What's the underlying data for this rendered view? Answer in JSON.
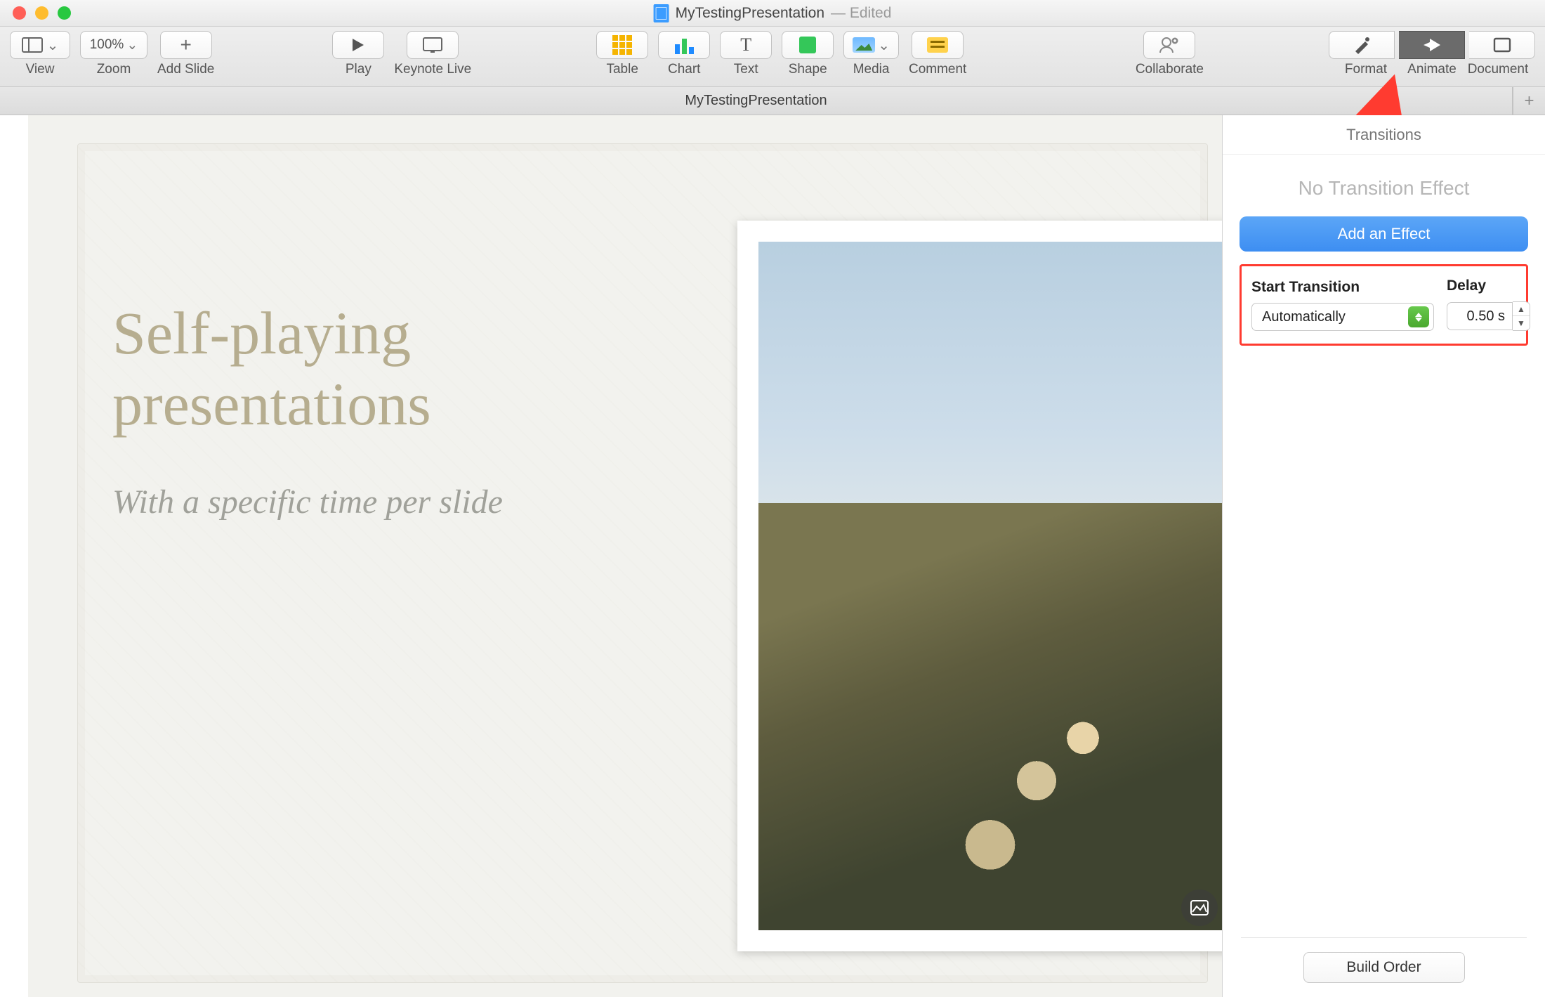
{
  "titlebar": {
    "document_name": "MyTestingPresentation",
    "edited_suffix": " — Edited"
  },
  "toolbar": {
    "view": "View",
    "zoom": "Zoom",
    "zoom_value": "100%",
    "add_slide": "Add Slide",
    "play": "Play",
    "keynote_live": "Keynote Live",
    "table": "Table",
    "chart": "Chart",
    "text": "Text",
    "shape": "Shape",
    "media": "Media",
    "comment": "Comment",
    "collaborate": "Collaborate",
    "format": "Format",
    "animate": "Animate",
    "document": "Document"
  },
  "tabs": {
    "tab1": "MyTestingPresentation"
  },
  "slide": {
    "heading": "Self-playing presentations",
    "subheading": "With a specific time per slide"
  },
  "inspector": {
    "header": "Transitions",
    "no_effect": "No Transition Effect",
    "add_effect_btn": "Add an Effect",
    "start_label": "Start Transition",
    "start_value": "Automatically",
    "delay_label": "Delay",
    "delay_value": "0.50 s",
    "build_order": "Build Order"
  },
  "colors": {
    "accent_blue": "#3d8ef2",
    "highlight_red": "#ff3b30"
  }
}
